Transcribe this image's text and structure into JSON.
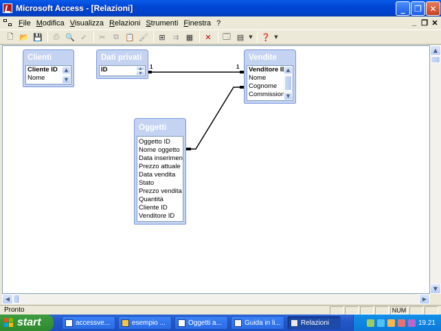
{
  "window": {
    "title": "Microsoft Access - [Relazioni]"
  },
  "menu": [
    "File",
    "Modifica",
    "Visualizza",
    "Relazioni",
    "Strumenti",
    "Finestra",
    "?"
  ],
  "tables": {
    "clienti": {
      "title": "Clienti",
      "fields": [
        "Cliente ID",
        "Nome"
      ]
    },
    "dati_privati": {
      "title": "Dati privati",
      "fields": [
        "ID"
      ]
    },
    "vendite": {
      "title": "Vendite",
      "fields": [
        "Venditore ID",
        "Nome",
        "Cognome",
        "Commissione"
      ]
    },
    "oggetti": {
      "title": "Oggetti",
      "fields": [
        "Oggetto ID",
        "Nome oggetto",
        "Data inserimento",
        "Prezzo attuale",
        "Data vendita",
        "Stato",
        "Prezzo vendita",
        "Quantità",
        "Cliente ID",
        "Venditore ID"
      ]
    }
  },
  "relations": {
    "one_label_left": "1",
    "one_label_right": "1"
  },
  "status": {
    "text": "Pronto",
    "num": "NUM"
  },
  "taskbar": {
    "start": "start",
    "tasks": [
      "accessve...",
      "esempio ...",
      "Oggetti a...",
      "Guida in li...",
      "Relazioni"
    ],
    "clock": "19.21"
  }
}
